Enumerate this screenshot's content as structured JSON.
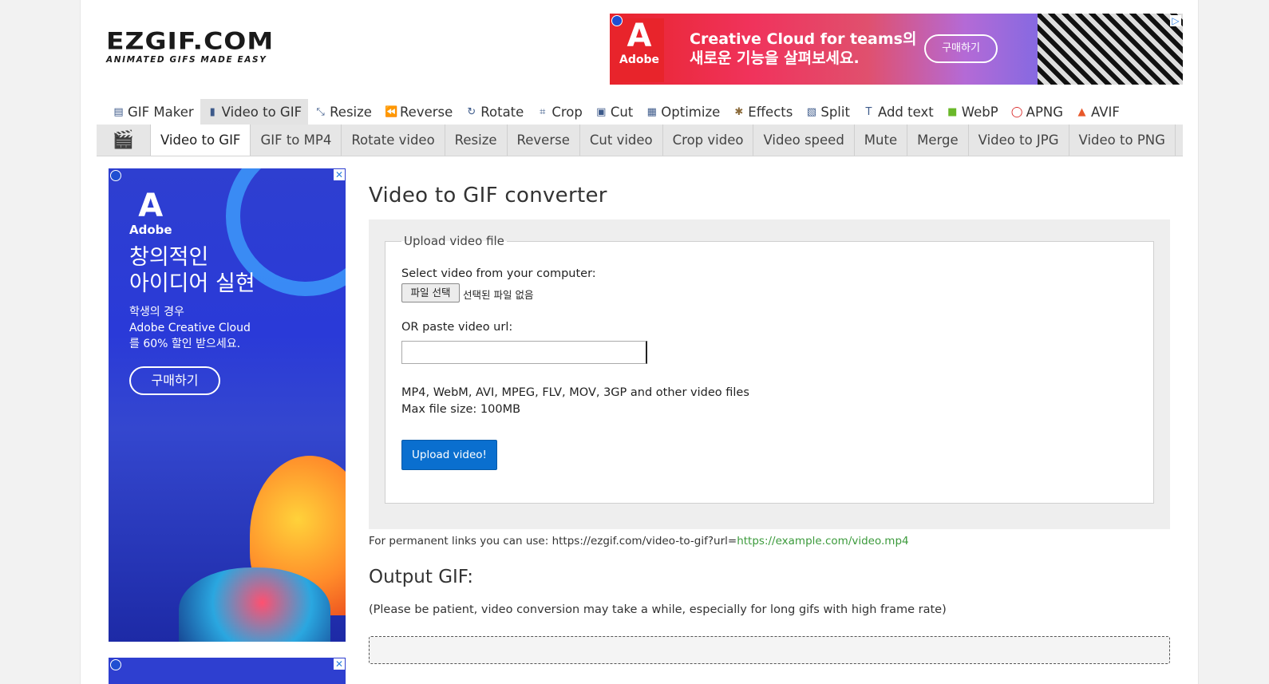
{
  "logo": {
    "main": "EZGIF.COM",
    "tagline": "ANIMATED GIFS MADE EASY"
  },
  "ad_top": {
    "brand": "Adobe",
    "headline_line1": "Creative Cloud for teams의",
    "headline_line2": "새로운 기능을 살펴보세요.",
    "button": "구매하기"
  },
  "main_nav": [
    {
      "label": "GIF Maker",
      "icon": "gif-maker-icon",
      "glyph": "▤"
    },
    {
      "label": "Video to GIF",
      "icon": "video-icon",
      "glyph": "▮",
      "active": true
    },
    {
      "label": "Resize",
      "icon": "resize-icon",
      "glyph": "⤡"
    },
    {
      "label": "Reverse",
      "icon": "reverse-icon",
      "glyph": "⏪"
    },
    {
      "label": "Rotate",
      "icon": "rotate-icon",
      "glyph": "↻"
    },
    {
      "label": "Crop",
      "icon": "crop-icon",
      "glyph": "⌗"
    },
    {
      "label": "Cut",
      "icon": "cut-icon",
      "glyph": "▣"
    },
    {
      "label": "Optimize",
      "icon": "optimize-icon",
      "glyph": "▦"
    },
    {
      "label": "Effects",
      "icon": "effects-icon",
      "glyph": "✱"
    },
    {
      "label": "Split",
      "icon": "split-icon",
      "glyph": "▧"
    },
    {
      "label": "Add text",
      "icon": "add-text-icon",
      "glyph": "T"
    },
    {
      "label": "WebP",
      "icon": "webp-icon",
      "glyph": "■"
    },
    {
      "label": "APNG",
      "icon": "apng-icon",
      "glyph": "◯"
    },
    {
      "label": "AVIF",
      "icon": "avif-icon",
      "glyph": "▲"
    }
  ],
  "sub_nav": [
    {
      "label": "Video to GIF",
      "active": true
    },
    {
      "label": "GIF to MP4"
    },
    {
      "label": "Rotate video"
    },
    {
      "label": "Resize"
    },
    {
      "label": "Reverse"
    },
    {
      "label": "Cut video"
    },
    {
      "label": "Crop video"
    },
    {
      "label": "Video speed"
    },
    {
      "label": "Mute"
    },
    {
      "label": "Merge"
    },
    {
      "label": "Video to JPG"
    },
    {
      "label": "Video to PNG"
    }
  ],
  "ad_side": {
    "brand": "Adobe",
    "headline_line1": "창의적인",
    "headline_line2": "아이디어 실현",
    "body_line1": "학생의 경우",
    "body_line2": "Adobe Creative Cloud",
    "body_line3": "를 60% 할인 받으세요.",
    "button": "구매하기"
  },
  "content": {
    "title": "Video to GIF converter",
    "legend": "Upload video file",
    "select_label": "Select video from your computer:",
    "file_button": "파일 선택",
    "file_status": "선택된 파일 없음",
    "url_label": "OR paste video url:",
    "url_value": "",
    "formats": "MP4, WebM, AVI, MPEG, FLV, MOV, 3GP and other video files",
    "max_size": "Max file size: 100MB",
    "upload_button": "Upload video!",
    "perm_prefix": "For permanent links you can use: https://ezgif.com/video-to-gif?url=",
    "perm_example": "https://example.com/video.mp4",
    "output_title": "Output GIF:",
    "patience_note": "(Please be patient, video conversion may take a while, especially for long gifs with high frame rate)"
  },
  "colors": {
    "upload_button": "#0a6fcf",
    "perm_link": "#3b9a3b",
    "subnav_bg": "#e6e6e6",
    "panel_bg": "#eeeeee"
  }
}
